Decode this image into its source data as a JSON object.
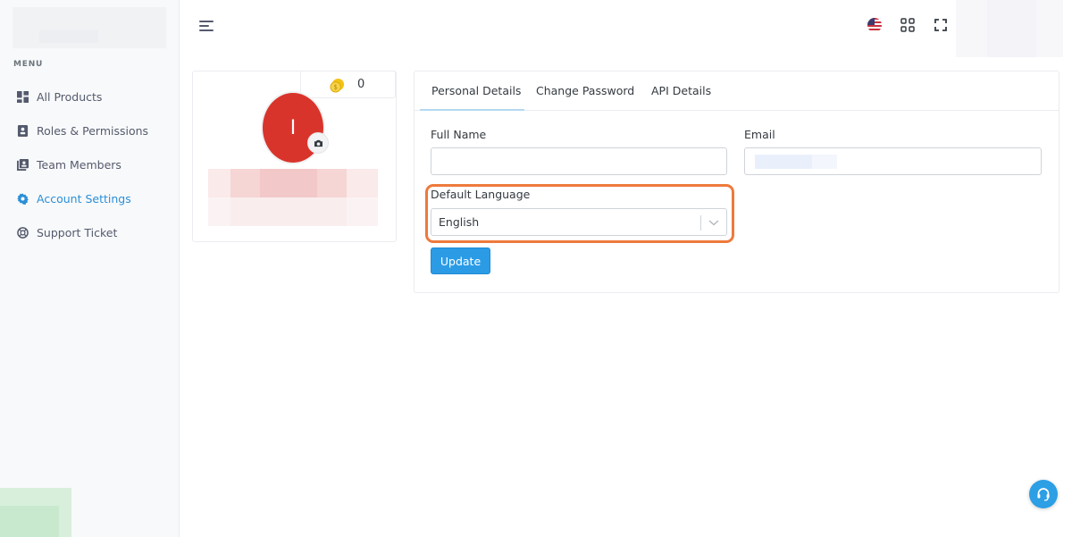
{
  "sidebar": {
    "menu_title": "MENU",
    "items": [
      {
        "label": "All Products",
        "icon": "grid-icon"
      },
      {
        "label": "Roles & Permissions",
        "icon": "id-badge-icon"
      },
      {
        "label": "Team Members",
        "icon": "contacts-icon"
      },
      {
        "label": "Account Settings",
        "icon": "gear-icon",
        "active": true
      },
      {
        "label": "Support Ticket",
        "icon": "lifebuoy-icon"
      }
    ]
  },
  "profile": {
    "coin_count": "0",
    "avatar_initial": "I"
  },
  "tabs": [
    {
      "label": "Personal Details",
      "active": true
    },
    {
      "label": "Change Password"
    },
    {
      "label": "API Details"
    }
  ],
  "form": {
    "full_name_label": "Full Name",
    "full_name_value": "",
    "email_label": "Email",
    "default_language_label": "Default Language",
    "default_language_value": "English",
    "update_label": "Update"
  },
  "colors": {
    "accent": "#2b9be6",
    "highlight": "#ee7a3c",
    "avatar": "#d9342b"
  }
}
